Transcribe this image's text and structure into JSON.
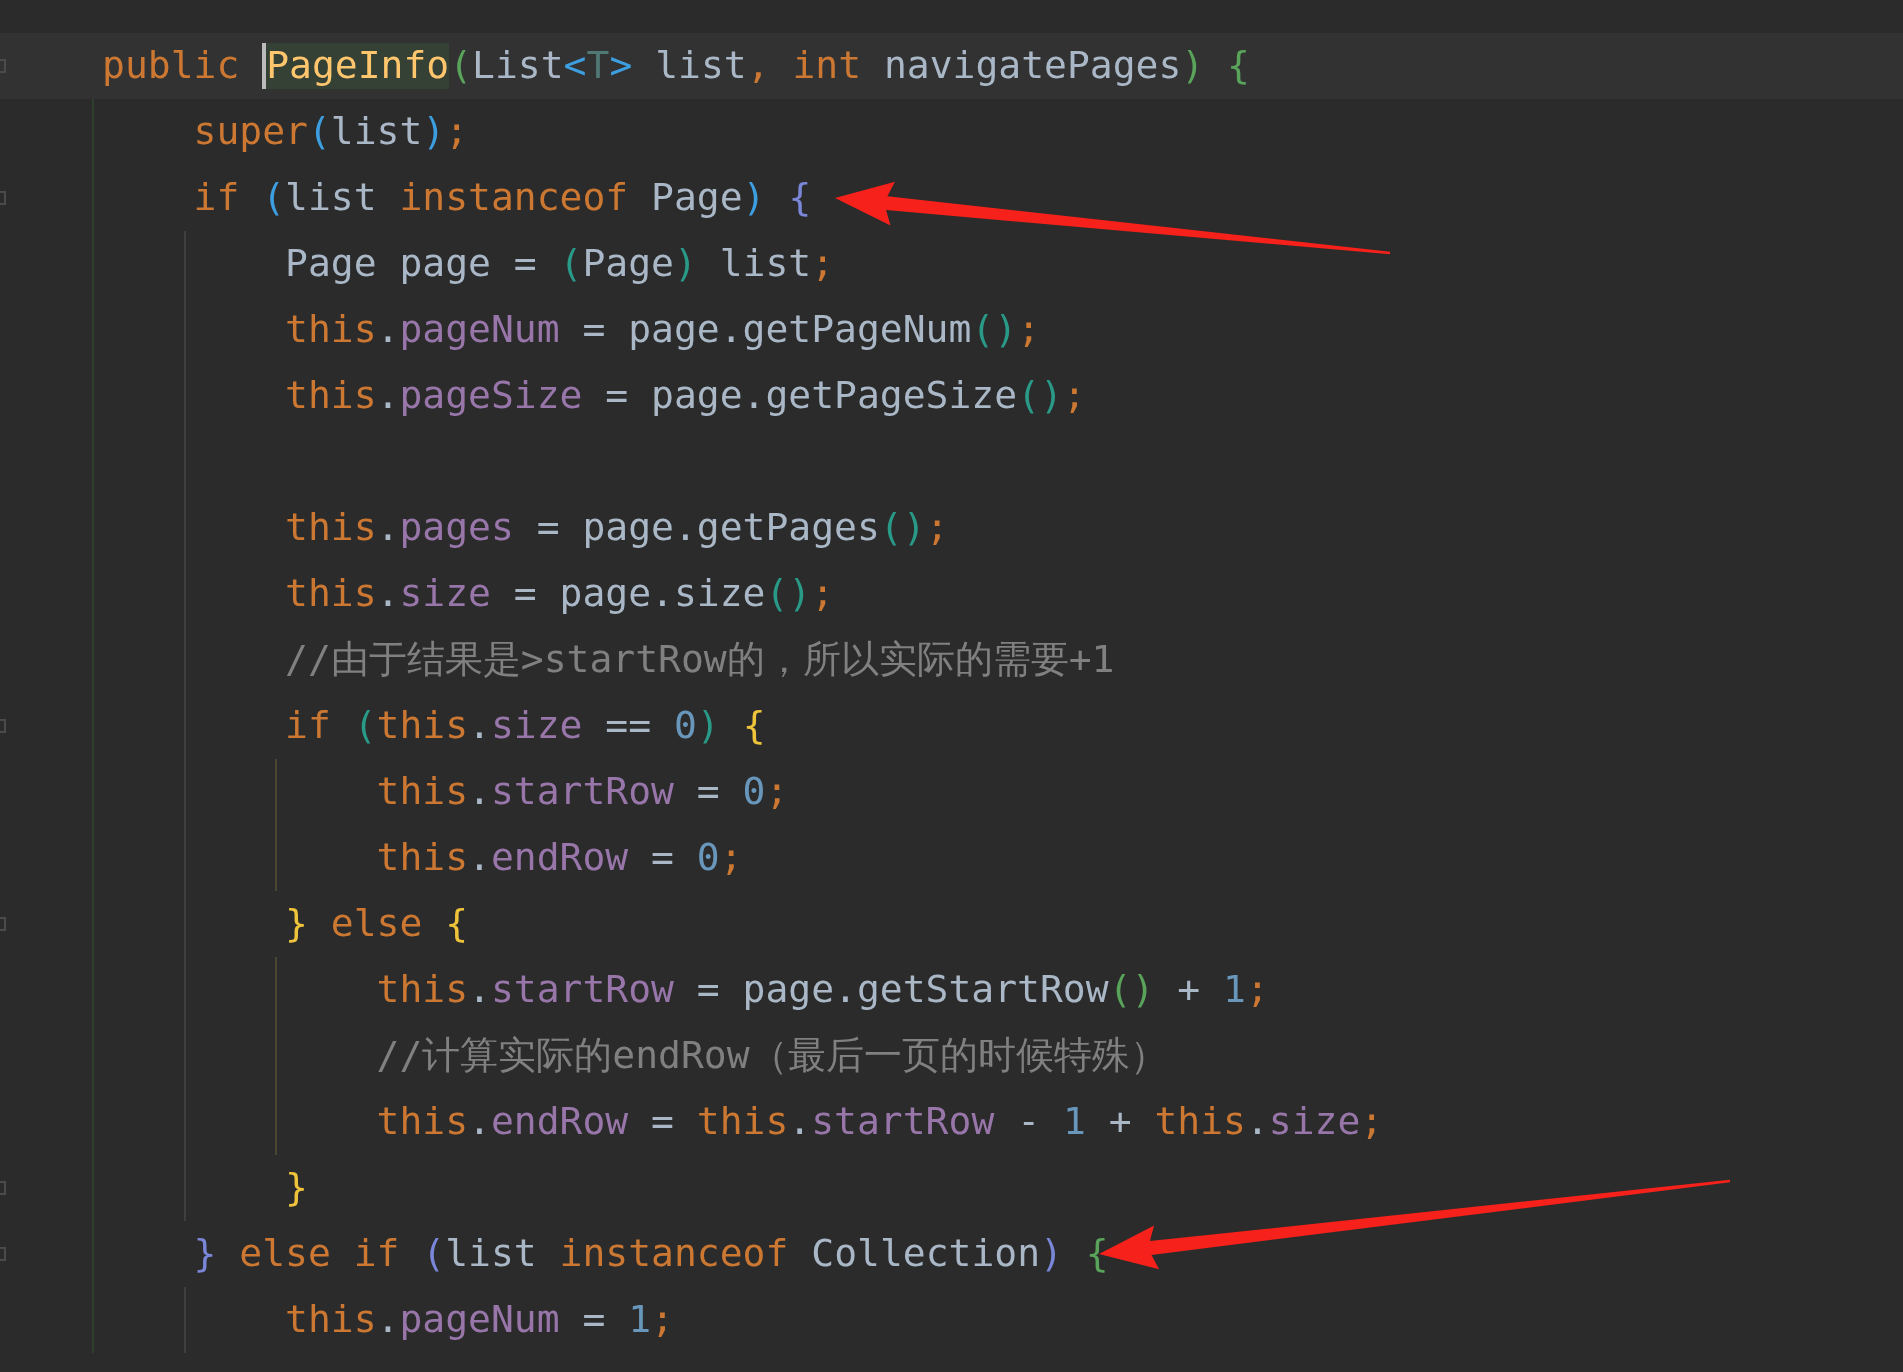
{
  "editor": {
    "lines": [
      {
        "current": true,
        "fold": true,
        "tokens": [
          {
            "text": "public ",
            "kind": "keyword"
          },
          {
            "text": "PageInfo",
            "kind": "declaration",
            "caret": true,
            "highlighted": true
          },
          {
            "text": "(",
            "kind": "bracket",
            "color": "#59a35a"
          },
          {
            "text": "List",
            "kind": "plain"
          },
          {
            "text": "<",
            "kind": "bracket",
            "color": "#3d9ee0"
          },
          {
            "text": "T",
            "kind": "typeparam"
          },
          {
            "text": ">",
            "kind": "bracket",
            "color": "#3d9ee0"
          },
          {
            "text": " list",
            "kind": "plain"
          },
          {
            "text": ", int",
            "kind": "keyword"
          },
          {
            "text": " navigatePages",
            "kind": "plain"
          },
          {
            "text": ")",
            "kind": "bracket",
            "color": "#59a35a"
          },
          {
            "text": " {",
            "kind": "bracket",
            "color": "#59a35a"
          }
        ],
        "children": [
          {
            "tokens": [
              {
                "text": "super",
                "kind": "keyword"
              },
              {
                "text": "(",
                "kind": "bracket",
                "color": "#3d9ee0"
              },
              {
                "text": "list",
                "kind": "plain"
              },
              {
                "text": ")",
                "kind": "bracket",
                "color": "#3d9ee0"
              },
              {
                "text": ";",
                "kind": "keyword"
              }
            ]
          },
          {
            "fold": true,
            "arrow": true,
            "arrow_rising": false,
            "tokens": [
              {
                "text": "if ",
                "kind": "keyword"
              },
              {
                "text": "(",
                "kind": "bracket",
                "color": "#3d9ee0"
              },
              {
                "text": "list ",
                "kind": "plain"
              },
              {
                "text": "instanceof ",
                "kind": "keyword"
              },
              {
                "text": "Page",
                "kind": "plain"
              },
              {
                "text": ")",
                "kind": "bracket",
                "color": "#3d9ee0"
              },
              {
                "text": " {",
                "kind": "bracket",
                "color": "#7a86d8"
              }
            ],
            "children": [
              {
                "tokens": [
                  {
                    "text": "Page page = ",
                    "kind": "plain"
                  },
                  {
                    "text": "(",
                    "kind": "bracket",
                    "color": "#2a9a88"
                  },
                  {
                    "text": "Page",
                    "kind": "plain"
                  },
                  {
                    "text": ")",
                    "kind": "bracket",
                    "color": "#2a9a88"
                  },
                  {
                    "text": " list",
                    "kind": "plain"
                  },
                  {
                    "text": ";",
                    "kind": "keyword"
                  }
                ]
              },
              {
                "tokens": [
                  {
                    "text": "this",
                    "kind": "keyword"
                  },
                  {
                    "text": ".",
                    "kind": "plain"
                  },
                  {
                    "text": "pageNum",
                    "kind": "field"
                  },
                  {
                    "text": " = page.getPageNum",
                    "kind": "plain"
                  },
                  {
                    "text": "(",
                    "kind": "bracket",
                    "color": "#2a9a88"
                  },
                  {
                    "text": ")",
                    "kind": "bracket",
                    "color": "#2a9a88"
                  },
                  {
                    "text": ";",
                    "kind": "keyword"
                  }
                ]
              },
              {
                "tokens": [
                  {
                    "text": "this",
                    "kind": "keyword"
                  },
                  {
                    "text": ".",
                    "kind": "plain"
                  },
                  {
                    "text": "pageSize",
                    "kind": "field"
                  },
                  {
                    "text": " = page.getPageSize",
                    "kind": "plain"
                  },
                  {
                    "text": "(",
                    "kind": "bracket",
                    "color": "#2a9a88"
                  },
                  {
                    "text": ")",
                    "kind": "bracket",
                    "color": "#2a9a88"
                  },
                  {
                    "text": ";",
                    "kind": "keyword"
                  }
                ]
              },
              {
                "kind": "blank"
              },
              {
                "tokens": [
                  {
                    "text": "this",
                    "kind": "keyword"
                  },
                  {
                    "text": ".",
                    "kind": "plain"
                  },
                  {
                    "text": "pages",
                    "kind": "field"
                  },
                  {
                    "text": " = page.getPages",
                    "kind": "plain"
                  },
                  {
                    "text": "(",
                    "kind": "bracket",
                    "color": "#2a9a88"
                  },
                  {
                    "text": ")",
                    "kind": "bracket",
                    "color": "#2a9a88"
                  },
                  {
                    "text": ";",
                    "kind": "keyword"
                  }
                ]
              },
              {
                "tokens": [
                  {
                    "text": "this",
                    "kind": "keyword"
                  },
                  {
                    "text": ".",
                    "kind": "plain"
                  },
                  {
                    "text": "size",
                    "kind": "field"
                  },
                  {
                    "text": " = page.size",
                    "kind": "plain"
                  },
                  {
                    "text": "(",
                    "kind": "bracket",
                    "color": "#2a9a88"
                  },
                  {
                    "text": ")",
                    "kind": "bracket",
                    "color": "#2a9a88"
                  },
                  {
                    "text": ";",
                    "kind": "keyword"
                  }
                ]
              },
              {
                "tokens": [
                  {
                    "text": "//由于结果是>startRow的，所以实际的需要+1",
                    "kind": "comment"
                  }
                ]
              },
              {
                "fold": true,
                "tokens": [
                  {
                    "text": "if ",
                    "kind": "keyword"
                  },
                  {
                    "text": "(",
                    "kind": "bracket",
                    "color": "#2a9a88"
                  },
                  {
                    "text": "this",
                    "kind": "keyword"
                  },
                  {
                    "text": ".",
                    "kind": "plain"
                  },
                  {
                    "text": "size",
                    "kind": "field"
                  },
                  {
                    "text": " == ",
                    "kind": "plain"
                  },
                  {
                    "text": "0",
                    "kind": "number"
                  },
                  {
                    "text": ")",
                    "kind": "bracket",
                    "color": "#2a9a88"
                  },
                  {
                    "text": " {",
                    "kind": "bracket",
                    "color": "#f0c43a"
                  }
                ],
                "children": [
                  {
                    "tokens": [
                      {
                        "text": "this",
                        "kind": "keyword"
                      },
                      {
                        "text": ".",
                        "kind": "plain"
                      },
                      {
                        "text": "startRow",
                        "kind": "field"
                      },
                      {
                        "text": " = ",
                        "kind": "plain"
                      },
                      {
                        "text": "0",
                        "kind": "number"
                      },
                      {
                        "text": ";",
                        "kind": "keyword"
                      }
                    ]
                  },
                  {
                    "tokens": [
                      {
                        "text": "this",
                        "kind": "keyword"
                      },
                      {
                        "text": ".",
                        "kind": "plain"
                      },
                      {
                        "text": "endRow",
                        "kind": "field"
                      },
                      {
                        "text": " = ",
                        "kind": "plain"
                      },
                      {
                        "text": "0",
                        "kind": "number"
                      },
                      {
                        "text": ";",
                        "kind": "keyword"
                      }
                    ]
                  }
                ]
              },
              {
                "fold": true,
                "tokens": [
                  {
                    "text": "}",
                    "kind": "bracket",
                    "color": "#f0c43a"
                  },
                  {
                    "text": " else ",
                    "kind": "keyword"
                  },
                  {
                    "text": "{",
                    "kind": "bracket",
                    "color": "#f0c43a"
                  }
                ],
                "children": [
                  {
                    "tokens": [
                      {
                        "text": "this",
                        "kind": "keyword"
                      },
                      {
                        "text": ".",
                        "kind": "plain"
                      },
                      {
                        "text": "startRow",
                        "kind": "field"
                      },
                      {
                        "text": " = page.getStartRow",
                        "kind": "plain"
                      },
                      {
                        "text": "(",
                        "kind": "bracket",
                        "color": "#59a35a"
                      },
                      {
                        "text": ")",
                        "kind": "bracket",
                        "color": "#59a35a"
                      },
                      {
                        "text": " + ",
                        "kind": "plain"
                      },
                      {
                        "text": "1",
                        "kind": "number"
                      },
                      {
                        "text": ";",
                        "kind": "keyword"
                      }
                    ]
                  },
                  {
                    "tokens": [
                      {
                        "text": "//计算实际的endRow（最后一页的时候特殊）",
                        "kind": "comment"
                      }
                    ]
                  },
                  {
                    "tokens": [
                      {
                        "text": "this",
                        "kind": "keyword"
                      },
                      {
                        "text": ".",
                        "kind": "plain"
                      },
                      {
                        "text": "endRow",
                        "kind": "field"
                      },
                      {
                        "text": " = ",
                        "kind": "plain"
                      },
                      {
                        "text": "this",
                        "kind": "keyword"
                      },
                      {
                        "text": ".",
                        "kind": "plain"
                      },
                      {
                        "text": "startRow",
                        "kind": "field"
                      },
                      {
                        "text": " - ",
                        "kind": "plain"
                      },
                      {
                        "text": "1",
                        "kind": "number"
                      },
                      {
                        "text": " + ",
                        "kind": "plain"
                      },
                      {
                        "text": "this",
                        "kind": "keyword"
                      },
                      {
                        "text": ".",
                        "kind": "plain"
                      },
                      {
                        "text": "size",
                        "kind": "field"
                      },
                      {
                        "text": ";",
                        "kind": "keyword"
                      }
                    ]
                  }
                ]
              },
              {
                "fold": true,
                "tokens": [
                  {
                    "text": "}",
                    "kind": "bracket",
                    "color": "#f0c43a"
                  }
                ]
              }
            ]
          },
          {
            "fold": true,
            "arrow": true,
            "arrow_rising": true,
            "tokens": [
              {
                "text": "}",
                "kind": "bracket",
                "color": "#7a86d8"
              },
              {
                "text": " else if ",
                "kind": "keyword"
              },
              {
                "text": "(",
                "kind": "bracket",
                "color": "#7a86d8"
              },
              {
                "text": "list ",
                "kind": "plain"
              },
              {
                "text": "instanceof ",
                "kind": "keyword"
              },
              {
                "text": "Collection",
                "kind": "plain"
              },
              {
                "text": ")",
                "kind": "bracket",
                "color": "#7a86d8"
              },
              {
                "text": " {",
                "kind": "bracket",
                "color": "#59a35a"
              }
            ],
            "children": [
              {
                "tokens": [
                  {
                    "text": "this",
                    "kind": "keyword"
                  },
                  {
                    "text": ".",
                    "kind": "plain"
                  },
                  {
                    "text": "pageNum",
                    "kind": "field"
                  },
                  {
                    "text": " = ",
                    "kind": "plain"
                  },
                  {
                    "text": "1",
                    "kind": "number"
                  },
                  {
                    "text": ";",
                    "kind": "keyword"
                  }
                ]
              }
            ]
          }
        ]
      }
    ]
  }
}
